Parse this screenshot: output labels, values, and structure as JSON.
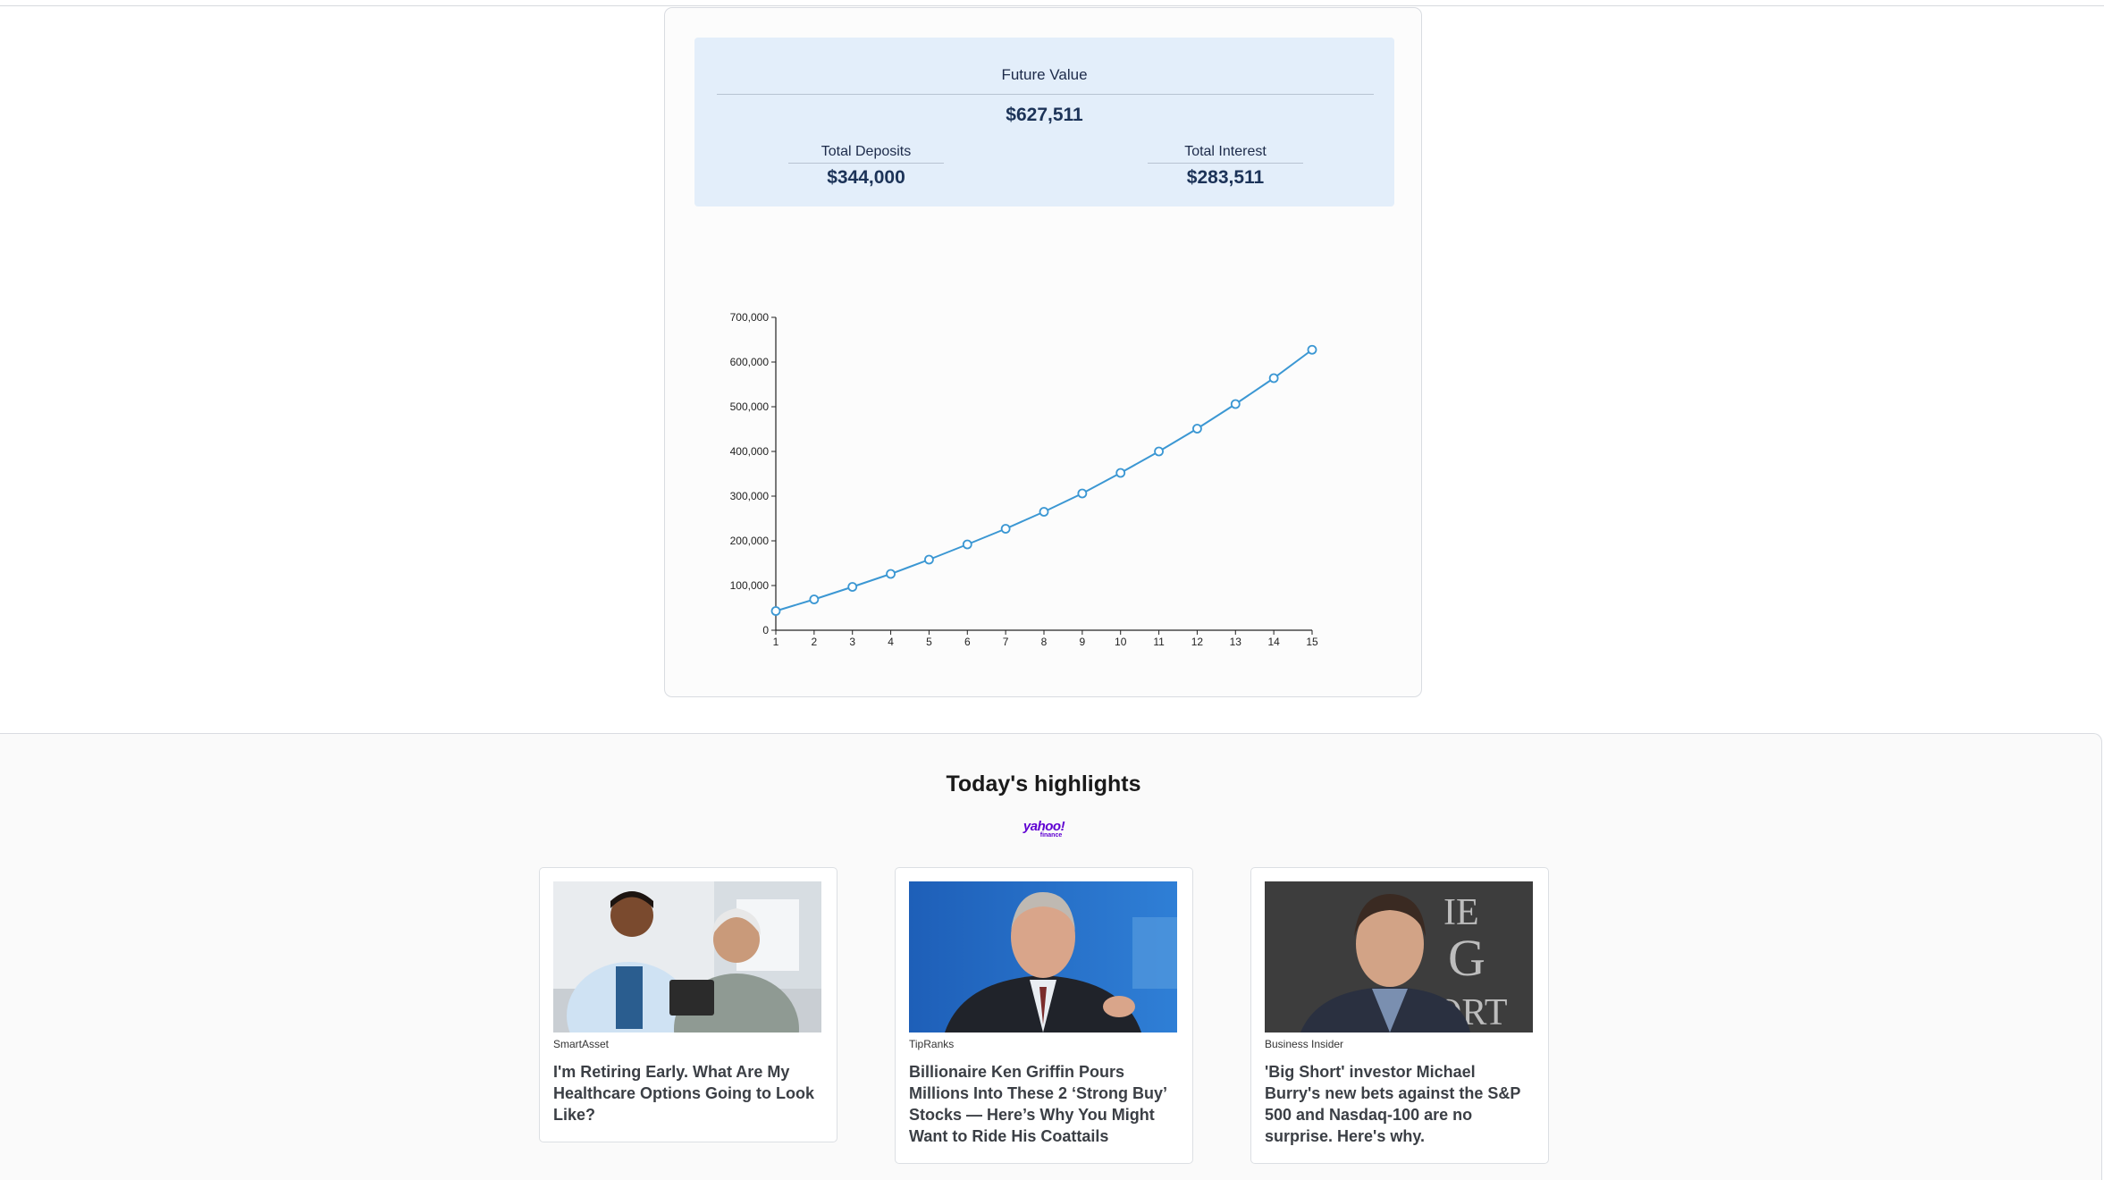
{
  "summary": {
    "future_value_label": "Future Value",
    "future_value": "$627,511",
    "total_deposits_label": "Total Deposits",
    "total_deposits": "$344,000",
    "total_interest_label": "Total Interest",
    "total_interest": "$283,511"
  },
  "chart_data": {
    "type": "line",
    "title": "",
    "xlabel": "",
    "ylabel": "",
    "x": [
      1,
      2,
      3,
      4,
      5,
      6,
      7,
      8,
      9,
      10,
      11,
      12,
      13,
      14,
      15
    ],
    "series": [
      {
        "values": [
          43000,
          69000,
          97000,
          126000,
          158000,
          192000,
          227000,
          265000,
          306000,
          352000,
          400000,
          451000,
          506000,
          564000,
          627511
        ]
      }
    ],
    "ylim": [
      0,
      700000
    ],
    "yticks": [
      0,
      100000,
      200000,
      300000,
      400000,
      500000,
      600000,
      700000
    ],
    "ytick_labels": [
      "0",
      "100,000",
      "200,000",
      "300,000",
      "400,000",
      "500,000",
      "600,000",
      "700,000"
    ],
    "xticks": [
      1,
      2,
      3,
      4,
      5,
      6,
      7,
      8,
      9,
      10,
      11,
      12,
      13,
      14,
      15
    ],
    "line_color": "#3b97d3",
    "grid": false
  },
  "highlights": {
    "title": "Today's highlights",
    "logo_text": "yahoo!",
    "logo_subtext": "finance",
    "articles": [
      {
        "source": "SmartAsset",
        "headline": "I'm Retiring Early. What Are My Healthcare Options Going to Look Like?"
      },
      {
        "source": "TipRanks",
        "headline": "Billionaire Ken Griffin Pours Millions Into These 2 ‘Strong Buy’ Stocks — Here’s Why You Might Want to Ride His Coattails"
      },
      {
        "source": "Business Insider",
        "headline": "'Big Short' investor Michael Burry's new bets against the S&P 500 and Nasdaq-100 are no surprise. Here's why."
      }
    ]
  }
}
